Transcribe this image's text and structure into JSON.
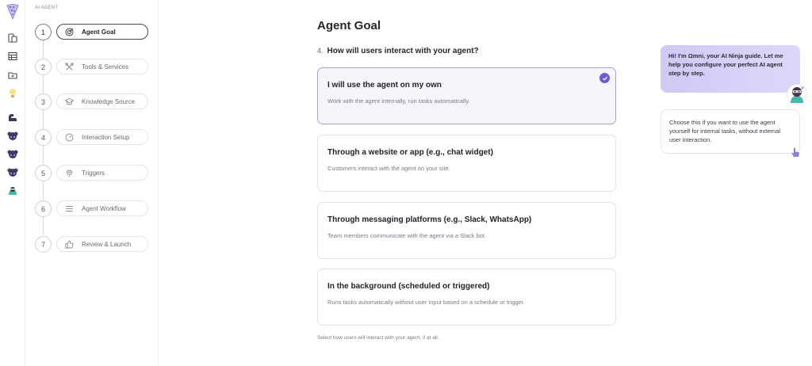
{
  "sidebar": {
    "section_label": "AI AGENT",
    "steps": [
      {
        "num": "1",
        "label": "Agent Goal",
        "icon": "target-icon"
      },
      {
        "num": "2",
        "label": "Tools & Services",
        "icon": "tools-icon"
      },
      {
        "num": "3",
        "label": "Knowledge Source",
        "icon": "graduation-cap-icon"
      },
      {
        "num": "4",
        "label": "Interaction Setup",
        "icon": "gauge-icon"
      },
      {
        "num": "5",
        "label": "Triggers",
        "icon": "fingerprint-icon"
      },
      {
        "num": "6",
        "label": "Agent Workflow",
        "icon": "list-icon"
      },
      {
        "num": "7",
        "label": "Review & Launch",
        "icon": "thumbs-up-icon"
      }
    ],
    "active_step": "1"
  },
  "main": {
    "title": "Agent Goal",
    "question_number": "4.",
    "question": "How will users interact with your agent?",
    "options": [
      {
        "title": "I will use the agent on my own",
        "description": "Work with the agent internally, run tasks automatically.",
        "selected": true
      },
      {
        "title": "Through a website or app (e.g., chat widget)",
        "description": "Customers interact with the agent on your site.",
        "selected": false
      },
      {
        "title": "Through messaging platforms (e.g., Slack, WhatsApp)",
        "description": "Team members communicate with the agent via a Slack bot.",
        "selected": false
      },
      {
        "title": "In the background (scheduled or triggered)",
        "description": "Runs tasks automatically without user input based on a schedule or trigger.",
        "selected": false
      }
    ],
    "helper": "Select how users will interact with your agent, if at all."
  },
  "assistant": {
    "greeting": "Hi! I'm Ωmni, your AI Ninja guide. Let me help you configure your perfect AI agent step by step.",
    "hint": "Choose this if you want to use the agent yourself for internal tasks, without external user interaction."
  },
  "colors": {
    "accent": "#6c5dd3",
    "bubble": "#d6d1f8",
    "selected_bg": "#f6f5fc"
  }
}
